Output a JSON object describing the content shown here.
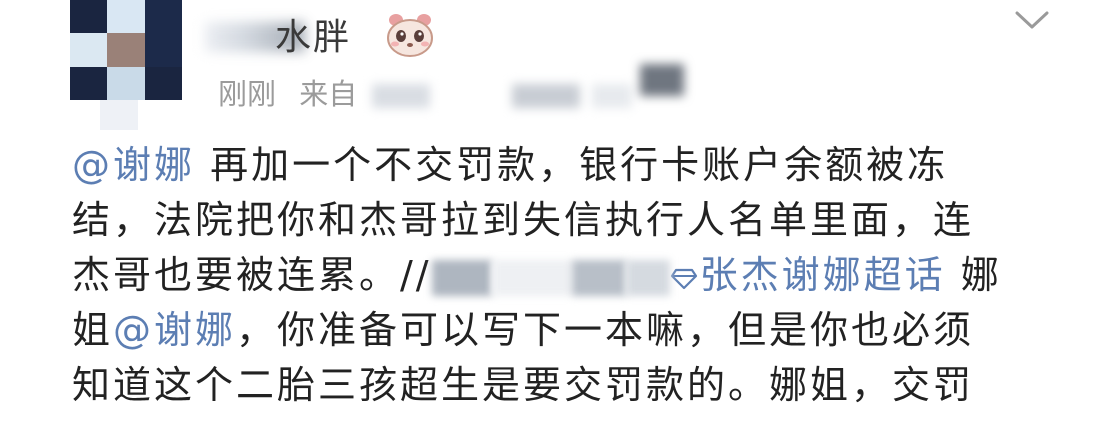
{
  "post": {
    "author": {
      "name_visible": "水胖",
      "avatar_pixels": [
        "#1a2540",
        "#d9e7f3",
        "#1c2a4a",
        "#dbe8f2",
        "#9a8178",
        "#1c2a4a",
        "#1a2540",
        "#c9dae8",
        "#1a2540"
      ]
    },
    "meta": {
      "time": "刚刚",
      "source_prefix": "来自"
    },
    "icons": {
      "badge": "panda-face-icon",
      "menu": "chevron-down-icon",
      "topic": "diamond-topic-icon"
    },
    "colors": {
      "link": "#5c7eb3",
      "text": "#222222",
      "meta": "#9b9b9b"
    },
    "body": {
      "line1_mention": "@谢娜",
      "line1_text": " 再加一个不交罚款，银行卡账户余额被冻",
      "line2_text": "结，法院把你和杰哥拉到失信执行人名单里面，连",
      "line3_text": "杰哥也要被连累。//",
      "line3_topic": "张杰谢娜超话",
      "line3_tail": " 娜",
      "line4_prefix": "姐",
      "line4_mention": "@谢娜",
      "line4_text": "，你准备可以写下一本嘛，但是你也必须",
      "line5_text": "知道这个二胎三孩超生是要交罚款的。娜姐，交罚"
    }
  }
}
